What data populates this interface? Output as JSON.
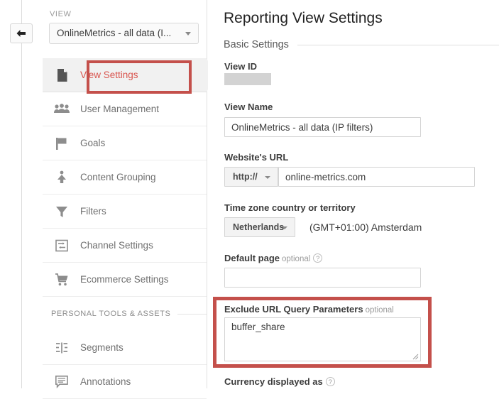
{
  "rail": {
    "back_button_icon": "arrow-left-icon"
  },
  "sidebar": {
    "view_label": "VIEW",
    "view_select_value": "OnlineMetrics - all data (I...",
    "items": [
      {
        "label": "View Settings",
        "icon": "document-icon",
        "active": true
      },
      {
        "label": "User Management",
        "icon": "people-icon",
        "active": false
      },
      {
        "label": "Goals",
        "icon": "flag-icon",
        "active": false
      },
      {
        "label": "Content Grouping",
        "icon": "content-grouping-icon",
        "active": false
      },
      {
        "label": "Filters",
        "icon": "funnel-icon",
        "active": false
      },
      {
        "label": "Channel Settings",
        "icon": "channel-icon",
        "active": false
      },
      {
        "label": "Ecommerce Settings",
        "icon": "cart-icon",
        "active": false
      }
    ],
    "section_title": "PERSONAL TOOLS & ASSETS",
    "personal_items": [
      {
        "label": "Segments",
        "icon": "segments-icon"
      },
      {
        "label": "Annotations",
        "icon": "annotation-icon"
      }
    ]
  },
  "main": {
    "page_title": "Reporting View Settings",
    "section_label": "Basic Settings",
    "fields": {
      "view_id": {
        "label": "View ID",
        "value": "",
        "redacted": true
      },
      "view_name": {
        "label": "View Name",
        "value": "OnlineMetrics - all data (IP filters)"
      },
      "website_url": {
        "label": "Website's URL",
        "protocol": "http://",
        "value": "online-metrics.com"
      },
      "time_zone": {
        "label": "Time zone country or territory",
        "country": "Netherlands",
        "zone": "(GMT+01:00) Amsterdam"
      },
      "default_page": {
        "label": "Default page",
        "optional": "optional",
        "help_icon": "question-mark-icon",
        "value": "",
        "placeholder": ""
      },
      "exclude_query_params": {
        "label": "Exclude URL Query Parameters",
        "optional": "optional",
        "value": "buffer_share"
      },
      "currency": {
        "label": "Currency displayed as",
        "help_icon": "question-mark-icon"
      }
    }
  },
  "annotations": {
    "highlight_color": "#c4504b",
    "accent_color": "#d9544e"
  }
}
